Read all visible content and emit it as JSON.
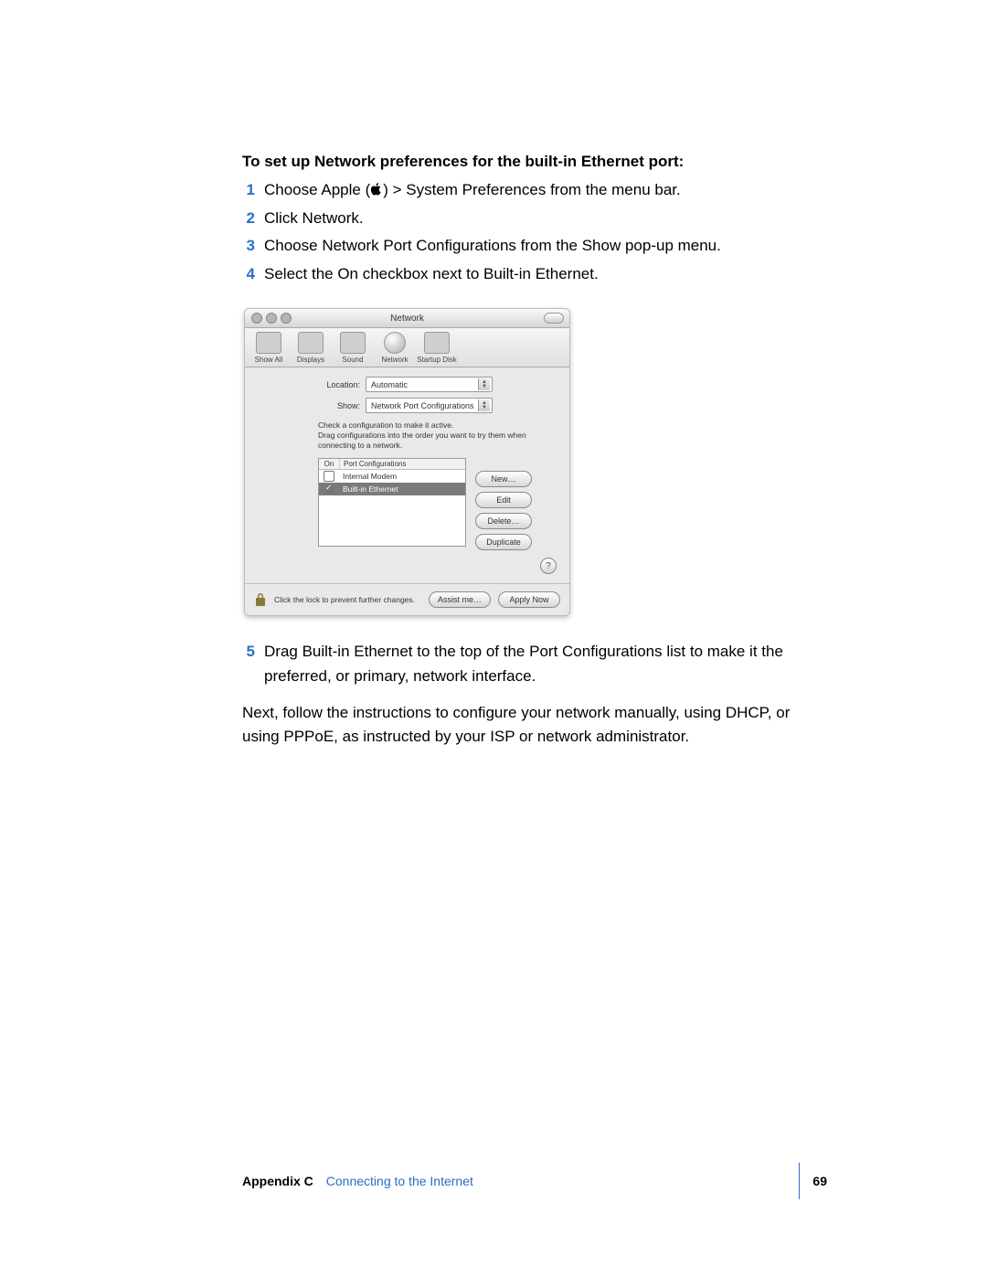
{
  "doc": {
    "heading": "To set up Network preferences for the built-in Ethernet port:",
    "steps": [
      {
        "n": "1",
        "text_before": "Choose Apple (",
        "text_after": ") > System Preferences from the menu bar."
      },
      {
        "n": "2",
        "text": "Click Network."
      },
      {
        "n": "3",
        "text": "Choose Network Port Configurations from the Show pop-up menu."
      },
      {
        "n": "4",
        "text": "Select the On checkbox next to Built-in Ethernet."
      }
    ],
    "step5": {
      "n": "5",
      "text": "Drag Built-in Ethernet to the top of the Port Configurations list to make it the preferred, or primary, network interface."
    },
    "para": "Next, follow the instructions to configure your network manually, using DHCP, or using PPPoE, as instructed by your ISP or network administrator."
  },
  "window": {
    "title": "Network",
    "toolbar": [
      {
        "label": "Show All"
      },
      {
        "label": "Displays"
      },
      {
        "label": "Sound"
      },
      {
        "label": "Network"
      },
      {
        "label": "Startup Disk"
      }
    ],
    "location_label": "Location:",
    "location_value": "Automatic",
    "show_label": "Show:",
    "show_value": "Network Port Configurations",
    "hint": "Check a configuration to make it active.\nDrag configurations into the order you want to try them when connecting to a network.",
    "list": {
      "col_on": "On",
      "col_name": "Port Configurations",
      "rows": [
        {
          "on": false,
          "name": "Internal Modem"
        },
        {
          "on": true,
          "name": "Built-in Ethernet",
          "selected": true
        }
      ]
    },
    "buttons": {
      "new": "New…",
      "edit": "Edit",
      "delete": "Delete…",
      "duplicate": "Duplicate"
    },
    "help": "?",
    "lock_text": "Click the lock to prevent further changes.",
    "assist": "Assist me…",
    "apply": "Apply Now"
  },
  "footer": {
    "appendix": "Appendix C",
    "title": "Connecting to the Internet",
    "page": "69"
  }
}
